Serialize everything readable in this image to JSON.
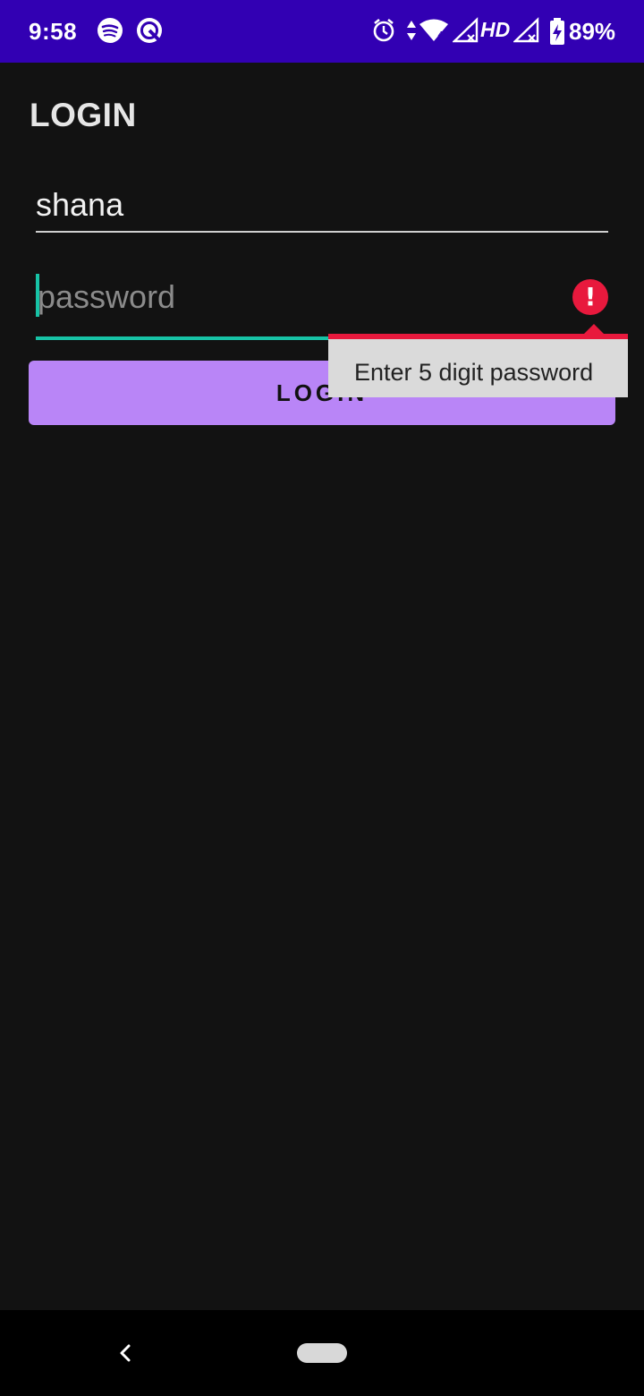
{
  "status_bar": {
    "time": "9:58",
    "left_icons": [
      "spotify-icon",
      "pocket-casts-icon"
    ],
    "right_icons": [
      "alarm-icon",
      "data-arrows-icon",
      "wifi-icon",
      "signal-icon",
      "signal-no-service-icon",
      "battery-charging-icon"
    ],
    "hd_label": "HD",
    "battery": "89%",
    "background": "#3200b3"
  },
  "screen": {
    "title": "LOGIN"
  },
  "form": {
    "username_value": "shana",
    "password_placeholder": "password",
    "password_value": "",
    "error_icon": "error-exclamation-icon",
    "error_message": "Enter 5 digit password",
    "login_label": "LOGIN"
  },
  "nav_bar": {
    "buttons": [
      "back-icon",
      "home-pill-icon"
    ]
  },
  "colors": {
    "background": "#121212",
    "accent": "#17c3a6",
    "button": "#b985f7",
    "error": "#e8193d",
    "tooltip_bg": "#dadada"
  }
}
